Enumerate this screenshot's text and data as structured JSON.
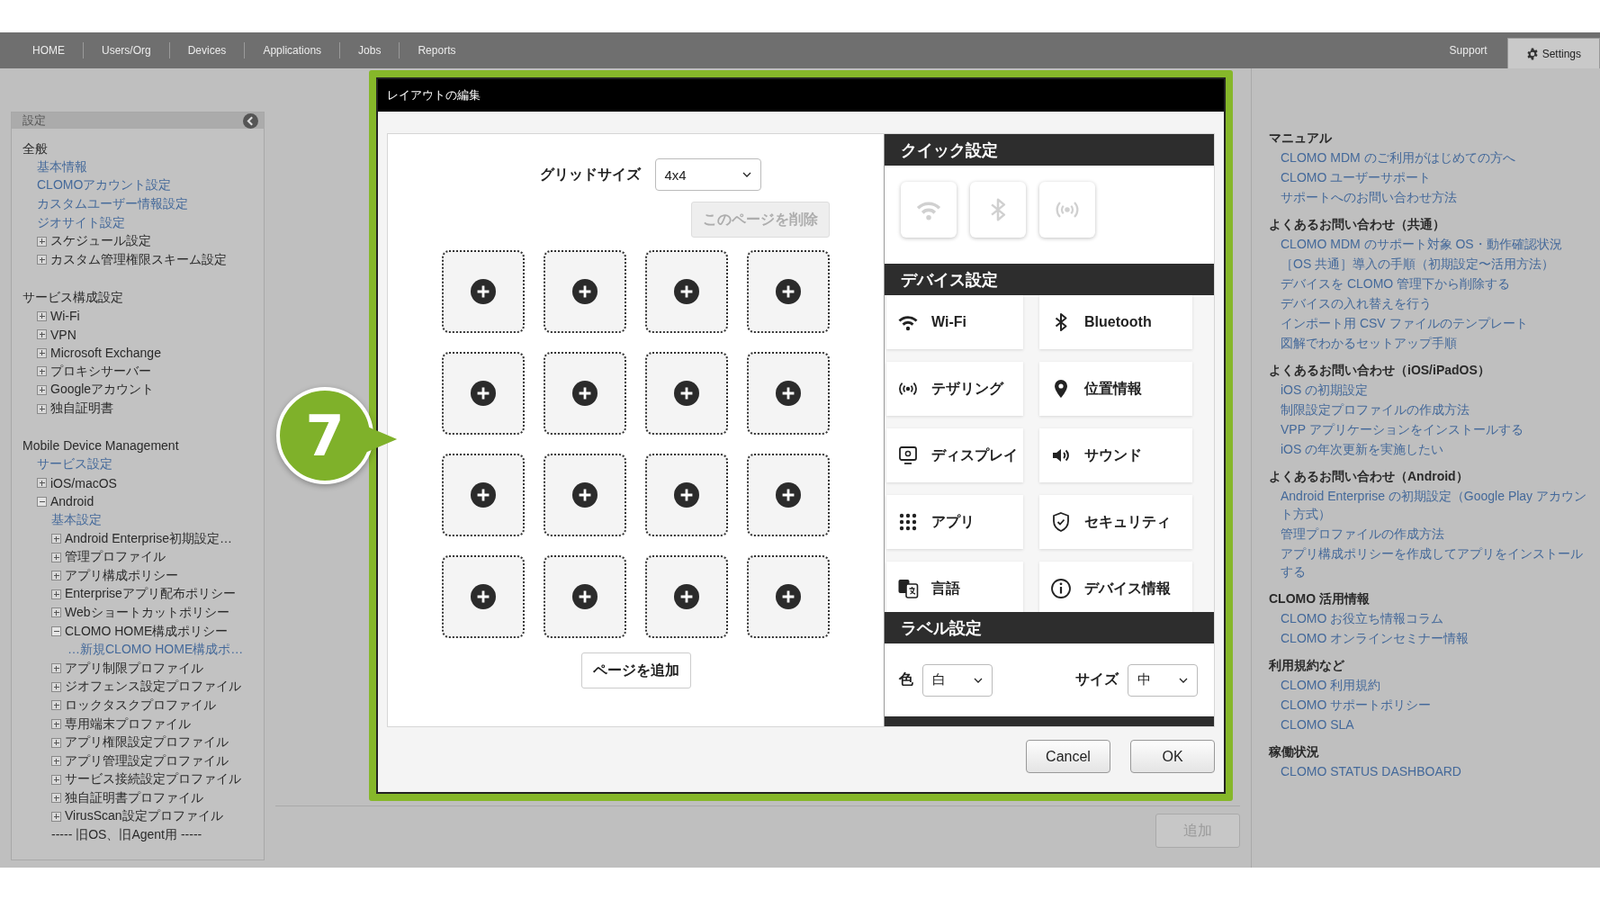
{
  "nav": {
    "tabs": [
      {
        "label": "HOME",
        "selected": false
      },
      {
        "label": "Users/Org",
        "selected": false
      },
      {
        "label": "Devices",
        "selected": false
      },
      {
        "label": "Applications",
        "selected": false
      },
      {
        "label": "Jobs",
        "selected": false
      },
      {
        "label": "Reports",
        "selected": false
      }
    ],
    "right_tabs": [
      {
        "label": "Support",
        "selected": false,
        "kind": "plain"
      },
      {
        "label": "Settings",
        "selected": true,
        "kind": "gear"
      }
    ]
  },
  "sidebar": {
    "title": "設定",
    "sections": [
      {
        "title": "全般",
        "items": [
          {
            "kind": "link",
            "label": "基本情報"
          },
          {
            "kind": "link",
            "label": "CLOMOアカウント設定"
          },
          {
            "kind": "link",
            "label": "カスタムユーザー情報設定"
          },
          {
            "kind": "link",
            "label": "ジオサイト設定"
          },
          {
            "kind": "node",
            "label": "スケジュール設定",
            "expanded": false
          },
          {
            "kind": "node",
            "label": "カスタム管理権限スキーム設定",
            "expanded": false
          }
        ]
      },
      {
        "title": "サービス構成設定",
        "items": [
          {
            "kind": "node",
            "label": "Wi-Fi",
            "expanded": false
          },
          {
            "kind": "node",
            "label": "VPN",
            "expanded": false
          },
          {
            "kind": "node",
            "label": "Microsoft Exchange",
            "expanded": false
          },
          {
            "kind": "node",
            "label": "プロキシサーバー",
            "expanded": false
          },
          {
            "kind": "node",
            "label": "Googleアカウント",
            "expanded": false
          },
          {
            "kind": "node",
            "label": "独自証明書",
            "expanded": false
          }
        ]
      },
      {
        "title": "Mobile Device Management",
        "items": [
          {
            "kind": "link",
            "label": "サービス設定"
          },
          {
            "kind": "node",
            "label": "iOS/macOS",
            "expanded": false
          },
          {
            "kind": "node",
            "label": "Android",
            "expanded": true,
            "children": [
              {
                "kind": "link",
                "label": "基本設定"
              },
              {
                "kind": "node",
                "label": "Android Enterprise初期設定…",
                "expanded": false
              },
              {
                "kind": "node",
                "label": "管理プロファイル",
                "expanded": false
              },
              {
                "kind": "node",
                "label": "アプリ構成ポリシー",
                "expanded": false
              },
              {
                "kind": "node",
                "label": "Enterpriseアプリ配布ポリシー",
                "expanded": false
              },
              {
                "kind": "node",
                "label": "Webショートカットポリシー",
                "expanded": false
              },
              {
                "kind": "node",
                "label": "CLOMO HOME構成ポリシー",
                "expanded": true,
                "children": [
                  {
                    "kind": "link",
                    "label": "…新規CLOMO HOME構成ポ…"
                  }
                ]
              },
              {
                "kind": "node",
                "label": "アプリ制限プロファイル",
                "expanded": false
              },
              {
                "kind": "node",
                "label": "ジオフェンス設定プロファイル",
                "expanded": false
              },
              {
                "kind": "node",
                "label": "ロックタスクプロファイル",
                "expanded": false
              },
              {
                "kind": "node",
                "label": "専用端末プロファイル",
                "expanded": false
              },
              {
                "kind": "node",
                "label": "アプリ権限設定プロファイル",
                "expanded": false
              },
              {
                "kind": "node",
                "label": "アプリ管理設定プロファイル",
                "expanded": false
              },
              {
                "kind": "node",
                "label": "サービス接続設定プロファイル",
                "expanded": false
              },
              {
                "kind": "node",
                "label": "独自証明書プロファイル",
                "expanded": false
              },
              {
                "kind": "node",
                "label": "VirusScan設定プロファイル",
                "expanded": false
              },
              {
                "kind": "separator",
                "label": "----- 旧OS、旧Agent用 -----"
              }
            ]
          }
        ]
      }
    ]
  },
  "main": {
    "add_button": {
      "label": "追加",
      "disabled": true
    }
  },
  "help": {
    "sections": [
      {
        "title": "マニュアル",
        "links": [
          "CLOMO MDM のご利用がはじめての方へ",
          "CLOMO ユーザーサポート",
          "サポートへのお問い合わせ方法"
        ]
      },
      {
        "title": "よくあるお問い合わせ（共通）",
        "links": [
          "CLOMO MDM のサポート対象 OS・動作確認状況",
          "［OS 共通］導入の手順（初期設定〜活用方法）",
          "デバイスを CLOMO 管理下から削除する",
          "デバイスの入れ替えを行う",
          "インポート用 CSV ファイルのテンプレート",
          "図解でわかるセットアップ手順"
        ]
      },
      {
        "title": "よくあるお問い合わせ（iOS/iPadOS）",
        "links": [
          "iOS の初期設定",
          "制限設定プロファイルの作成方法",
          "VPP アプリケーションをインストールする",
          "iOS の年次更新を実施したい"
        ]
      },
      {
        "title": "よくあるお問い合わせ（Android）",
        "links": [
          "Android Enterprise の初期設定（Google Play アカウント方式）",
          "管理プロファイルの作成方法",
          "アプリ構成ポリシーを作成してアプリをインストールする"
        ]
      },
      {
        "title": "CLOMO 活用情報",
        "links": [
          "CLOMO お役立ち情報コラム",
          "CLOMO オンラインセミナー情報"
        ]
      },
      {
        "title": "利用規約など",
        "links": [
          "CLOMO 利用規約",
          "CLOMO サポートポリシー",
          "CLOMO SLA"
        ]
      },
      {
        "title": "稼働状況",
        "links": [
          "CLOMO STATUS DASHBOARD"
        ]
      }
    ]
  },
  "dialog": {
    "title": "レイアウトの編集",
    "grid_size": {
      "label": "グリッドサイズ",
      "value": "4x4"
    },
    "delete_page": {
      "label": "このページを削除",
      "disabled": true
    },
    "slots": [
      {
        "filled": false
      },
      {
        "filled": false
      },
      {
        "filled": false
      },
      {
        "filled": false
      },
      {
        "filled": false
      },
      {
        "filled": false
      },
      {
        "filled": false
      },
      {
        "filled": false
      },
      {
        "filled": false
      },
      {
        "filled": false
      },
      {
        "filled": false
      },
      {
        "filled": false
      },
      {
        "filled": false
      },
      {
        "filled": false
      },
      {
        "filled": false
      },
      {
        "filled": false
      }
    ],
    "add_page": {
      "label": "ページを追加"
    },
    "panel": [
      {
        "kind": "quick",
        "title": "クイック設定",
        "tiles": [
          {
            "kind": "wifi"
          },
          {
            "kind": "bluetooth"
          },
          {
            "kind": "tethering"
          }
        ]
      },
      {
        "kind": "items",
        "title": "デバイス設定",
        "items": [
          {
            "kind": "wifi",
            "label": "Wi-Fi"
          },
          {
            "kind": "bluetooth",
            "label": "Bluetooth"
          },
          {
            "kind": "tethering",
            "label": "テザリング"
          },
          {
            "kind": "location",
            "label": "位置情報"
          },
          {
            "kind": "display",
            "label": "ディスプレイ"
          },
          {
            "kind": "sound",
            "label": "サウンド"
          },
          {
            "kind": "apps",
            "label": "アプリ"
          },
          {
            "kind": "security",
            "label": "セキュリティ"
          },
          {
            "kind": "language",
            "label": "言語"
          },
          {
            "kind": "info",
            "label": "デバイス情報"
          }
        ]
      },
      {
        "kind": "fields",
        "title": "ラベル設定",
        "fields": [
          {
            "label": "色",
            "value": "白"
          },
          {
            "label": "サイズ",
            "value": "中"
          }
        ]
      },
      {
        "kind": "cut"
      }
    ],
    "buttons": [
      {
        "label": "Cancel"
      },
      {
        "label": "OK"
      }
    ]
  },
  "step_badge": "7"
}
